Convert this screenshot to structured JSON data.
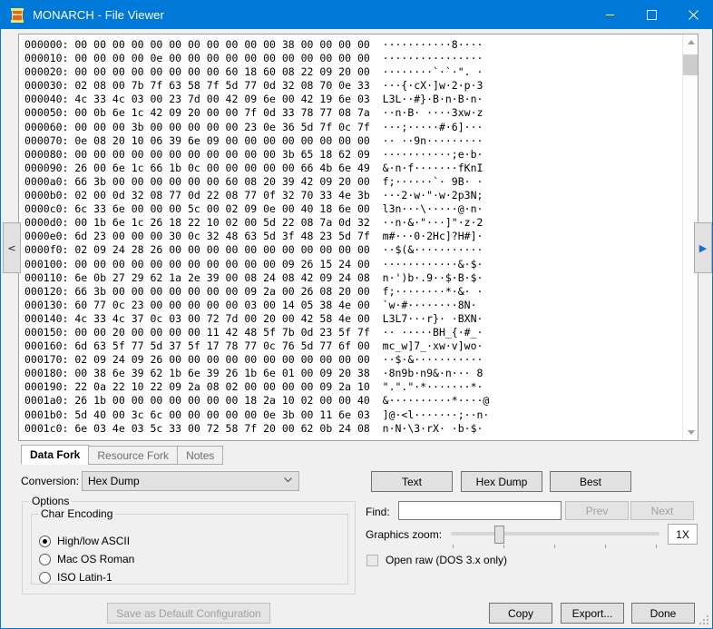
{
  "window": {
    "title": "MONARCH - File Viewer",
    "icon": "monarch-app-icon",
    "minimize_label": "—",
    "maximize_label": "□",
    "close_label": "✕",
    "accent_color": "#0078d7"
  },
  "sidenav": {
    "prev_label": "<",
    "next_label": "▶"
  },
  "hexview": {
    "lines": [
      "000000: 00 00 00 00 00 00 00 00 00 00 00 38 00 00 00 00  ···········8····",
      "000010: 00 00 00 00 0e 00 00 00 00 00 00 00 00 00 00 00  ················",
      "000020: 00 00 00 00 00 00 00 00 60 18 60 08 22 09 20 00  ········`·`·\". ·",
      "000030: 02 08 00 7b 7f 63 58 7f 5d 77 0d 32 08 70 0e 33  ···{·cX·]w·2·p·3",
      "000040: 4c 33 4c 03 00 23 7d 00 42 09 6e 00 42 19 6e 03  L3L··#}·B·n·B·n·",
      "000050: 00 0b 6e 1c 42 09 20 00 00 7f 0d 33 78 77 08 7a  ··n·B· ····3xw·z",
      "000060: 00 00 00 3b 00 00 00 00 00 23 0e 36 5d 7f 0c 7f  ···;·····#·6]···",
      "000070: 0e 08 20 10 06 39 6e 09 00 00 00 00 00 00 00 00  ·· ··9n·········",
      "000080: 00 00 00 00 00 00 00 00 00 00 00 3b 65 18 62 09  ···········;e·b·",
      "000090: 26 00 6e 1c 66 1b 0c 00 00 00 00 00 66 4b 6e 49  &·n·f·······fKnI",
      "0000a0: 66 3b 00 00 00 00 00 00 60 08 20 39 42 09 20 00  f;······`· 9B· ·",
      "0000b0: 02 00 0d 32 08 77 0d 22 08 77 0f 32 70 33 4e 3b  ···2·w·\"·w·2p3N;",
      "0000c0: 6c 33 6e 00 00 00 5c 00 02 09 0e 00 40 18 6e 00  l3n···\\·····@·n·",
      "0000d0: 00 1b 6e 1c 26 18 22 10 02 00 5d 22 08 7a 0d 32  ··n·&·\"···]\"·z·2",
      "0000e0: 6d 23 00 00 00 30 0c 32 48 63 5d 3f 48 23 5d 7f  m#···0·2Hc]?H#]·",
      "0000f0: 02 09 24 28 26 00 00 00 00 00 00 00 00 00 00 00  ··$(&···········",
      "000100: 00 00 00 00 00 00 00 00 00 00 00 09 26 15 24 00  ············&·$·",
      "000110: 6e 0b 27 29 62 1a 2e 39 00 08 24 08 42 09 24 08  n·')b·.9··$·B·$·",
      "000120: 66 3b 00 00 00 00 00 00 00 09 2a 00 26 08 20 00  f;········*·&· ·",
      "000130: 60 77 0c 23 00 00 00 00 00 03 00 14 05 38 4e 00  `w·#········8N·",
      "000140: 4c 33 4c 37 0c 03 00 72 7d 00 20 00 42 58 4e 00  L3L7···r}· ·BXN·",
      "000150: 00 00 20 00 00 00 00 11 42 48 5f 7b 0d 23 5f 7f  ·· ·····BH_{·#_·",
      "000160: 6d 63 5f 77 5d 37 5f 17 78 77 0c 76 5d 77 6f 00  mc_w]7_·xw·v]wo·",
      "000170: 02 09 24 09 26 00 00 00 00 00 00 00 00 00 00 00  ··$·&···········",
      "000180: 00 38 6e 39 62 1b 6e 39 26 1b 6e 01 00 09 20 38  ·8n9b·n9&·n··· 8",
      "000190: 22 0a 22 10 22 09 2a 08 02 00 00 00 00 09 2a 10  \".\".\"·*·······*·",
      "0001a0: 26 1b 00 00 00 00 00 00 00 18 2a 10 02 00 00 40  &··········*····@",
      "0001b0: 5d 40 00 3c 6c 00 00 00 00 00 0e 3b 00 11 6e 03  ]@·<l·······;··n·",
      "0001c0: 6e 03 4e 03 5c 33 00 72 58 7f 20 00 62 0b 24 08  n·N·\\3·rX· ·b·$·"
    ],
    "scrollbar": {
      "up_arrow": "scroll-up-arrow",
      "down_arrow": "scroll-down-arrow"
    }
  },
  "tabs": [
    {
      "label": "Data Fork",
      "active": true,
      "enabled": true
    },
    {
      "label": "Resource Fork",
      "active": false,
      "enabled": false
    },
    {
      "label": "Notes",
      "active": false,
      "enabled": false
    }
  ],
  "conversion": {
    "label": "Conversion:",
    "value": "Hex Dump",
    "caret": "⌄"
  },
  "options": {
    "title": "Options",
    "char_encoding": {
      "title": "Char Encoding",
      "items": [
        {
          "label": "High/low ASCII",
          "checked": true
        },
        {
          "label": "Mac OS Roman",
          "checked": false
        },
        {
          "label": "ISO Latin-1",
          "checked": false
        }
      ]
    }
  },
  "view_buttons": [
    {
      "label": "Text",
      "enabled": true
    },
    {
      "label": "Hex Dump",
      "enabled": true
    },
    {
      "label": "Best",
      "enabled": true
    }
  ],
  "find": {
    "label": "Find:",
    "value": "",
    "placeholder": "",
    "prev_label": "Prev",
    "prev_enabled": false,
    "next_label": "Next",
    "next_enabled": false
  },
  "graphics_zoom": {
    "label": "Graphics zoom:",
    "value": "1X",
    "slider_position_percent": 22,
    "tick_count": 5
  },
  "open_raw": {
    "label": "Open raw (DOS 3.x only)",
    "checked": false,
    "enabled": false
  },
  "bottom_bar": {
    "save_default_label": "Save as Default Configuration",
    "save_default_enabled": false,
    "copy_label": "Copy",
    "export_label": "Export...",
    "done_label": "Done"
  }
}
